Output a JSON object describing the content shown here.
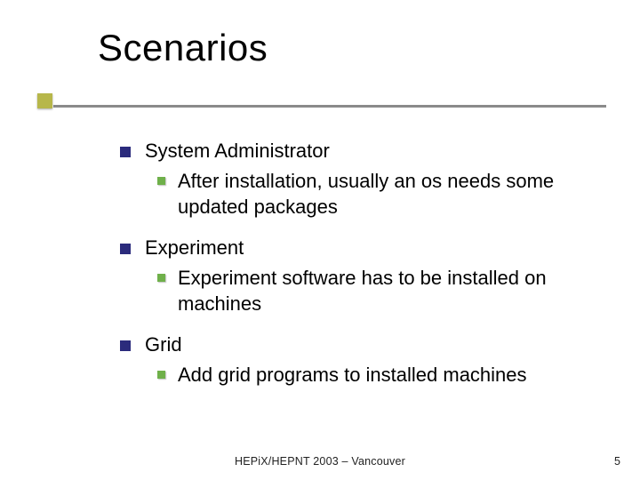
{
  "title": "Scenarios",
  "bullets": [
    {
      "label": "System Administrator",
      "sub": [
        "After installation, usually an os needs some updated packages"
      ]
    },
    {
      "label": "Experiment",
      "sub": [
        "Experiment software has to be installed on machines"
      ]
    },
    {
      "label": "Grid",
      "sub": [
        "Add grid programs to installed machines"
      ]
    }
  ],
  "footer": "HEPiX/HEPNT 2003 – Vancouver",
  "page_number": "5",
  "colors": {
    "bullet_l1": "#2b2b7c",
    "bullet_l2": "#6fb04a",
    "accent_square": "#b7b74a",
    "rule": "#8a8a8a"
  }
}
